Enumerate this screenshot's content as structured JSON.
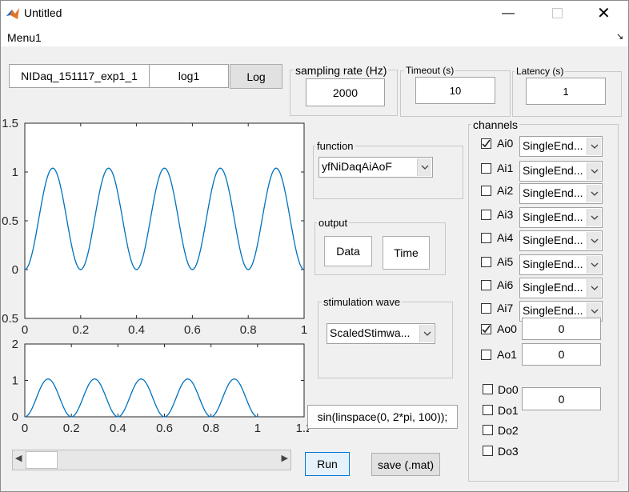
{
  "window": {
    "title": "Untitled",
    "menu": "Menu1"
  },
  "top": {
    "filename": "NIDaq_151117_exp1_1",
    "log_value": "log1",
    "log_button": "Log"
  },
  "sampling": {
    "label": "sampling rate (Hz)",
    "value": "2000"
  },
  "timeout": {
    "label": "Timeout (s)",
    "value": "10"
  },
  "latency": {
    "label": "Latency (s)",
    "value": "1"
  },
  "function": {
    "label": "function",
    "selected": "yfNiDaqAiAoF"
  },
  "output": {
    "label": "output",
    "data_button": "Data",
    "time_button": "Time"
  },
  "stim": {
    "label": "stimulation wave",
    "selected": "ScaledStimwa..."
  },
  "expression": "sin(linspace(0, 2*pi, 100));",
  "buttons": {
    "run": "Run",
    "save": "save (.mat)"
  },
  "channels": {
    "label": "channels",
    "ai": [
      {
        "name": "Ai0",
        "checked": true,
        "mode": "SingleEnd..."
      },
      {
        "name": "Ai1",
        "checked": false,
        "mode": "SingleEnd..."
      },
      {
        "name": "Ai2",
        "checked": false,
        "mode": "SingleEnd..."
      },
      {
        "name": "Ai3",
        "checked": false,
        "mode": "SingleEnd..."
      },
      {
        "name": "Ai4",
        "checked": false,
        "mode": "SingleEnd..."
      },
      {
        "name": "Ai5",
        "checked": false,
        "mode": "SingleEnd..."
      },
      {
        "name": "Ai6",
        "checked": false,
        "mode": "SingleEnd..."
      },
      {
        "name": "Ai7",
        "checked": false,
        "mode": "SingleEnd..."
      }
    ],
    "ao": [
      {
        "name": "Ao0",
        "checked": true,
        "value": "0"
      },
      {
        "name": "Ao1",
        "checked": false,
        "value": "0"
      }
    ],
    "do": [
      {
        "name": "Do0",
        "checked": false
      },
      {
        "name": "Do1",
        "checked": false
      },
      {
        "name": "Do2",
        "checked": false
      },
      {
        "name": "Do3",
        "checked": false
      }
    ],
    "do_value": "0"
  },
  "slider": {
    "value_fraction": 0.0
  },
  "chart_data": [
    {
      "type": "line",
      "title": "",
      "xlabel": "",
      "ylabel": "",
      "xlim": [
        0,
        1
      ],
      "ylim": [
        -0.5,
        1.5
      ],
      "xticks": [
        "0",
        "0.2",
        "0.4",
        "0.6",
        "0.8",
        "1"
      ],
      "yticks": [
        "0.5",
        "0",
        "0.5",
        "1",
        "1.5"
      ],
      "series": [
        {
          "function": "(1 - cos(2*pi*5*x))/2 * 1.04",
          "samples": 200
        }
      ],
      "color": "#0072bd"
    },
    {
      "type": "line",
      "title": "",
      "xlabel": "",
      "ylabel": "",
      "xlim": [
        0,
        1.2
      ],
      "ylim": [
        0,
        2
      ],
      "xticks": [
        "0",
        "0.2",
        "0.4",
        "0.6",
        "0.8",
        "1",
        "1.2"
      ],
      "yticks": [
        "0",
        "1",
        "2"
      ],
      "series": [
        {
          "function": "(1 - cos(2*pi*5*x))/2 * 1.04, x in [0,1]",
          "samples": 200
        }
      ],
      "color": "#0072bd"
    }
  ]
}
